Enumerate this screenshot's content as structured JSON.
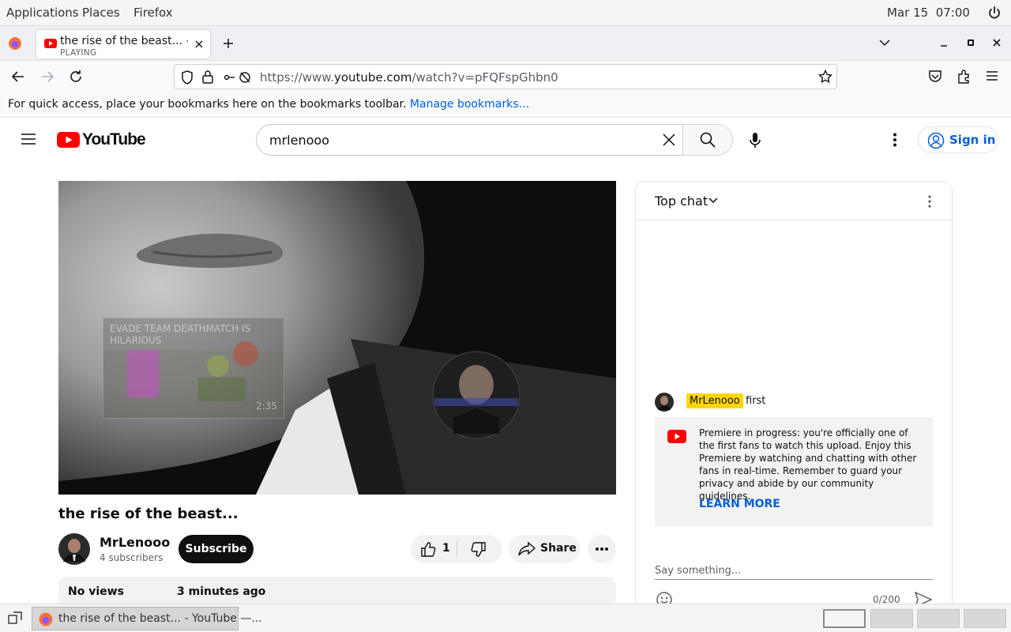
{
  "system_bar": {
    "menus": [
      "Applications",
      "Places",
      "Firefox"
    ],
    "datetime": "Mar 15  07:00"
  },
  "browser": {
    "tab": {
      "title": "the rise of the beast... - YouTube",
      "status": "PLAYING"
    },
    "url": {
      "prefix": "https://www.",
      "domain": "youtube.com",
      "path": "/watch?v=pFQFspGhbn0"
    },
    "bookmarks_message": "For quick access, place your bookmarks here on the bookmarks toolbar.",
    "bookmarks_link": "Manage bookmarks…"
  },
  "youtube": {
    "logo_text": "YouTube",
    "search_query": "mrlenooo",
    "sign_in_label": "Sign in"
  },
  "video": {
    "title": "the rise of the beast...",
    "endcard_title": "EVADE TEAM DEATHMATCH IS HILARIOUS",
    "endcard_duration": "2:35",
    "channel_name": "MrLenooo",
    "subscribers": "4 subscribers",
    "subscribe_label": "Subscribe",
    "like_count": "1",
    "share_label": "Share",
    "views": "No views",
    "posted": "3 minutes ago"
  },
  "chat": {
    "header": "Top chat",
    "message": {
      "author": "MrLenooo",
      "text": "first"
    },
    "banner_text": "Premiere in progress: you're officially one of the first fans to watch this upload. Enjoy this Premiere by watching and chatting with other fans in real-time. Remember to guard your privacy and abide by our community guidelines.",
    "learn_more": "LEARN MORE",
    "input_placeholder": "Say something...",
    "char_counter": "0/200"
  },
  "taskbar": {
    "window_title": "the rise of the beast... - YouTube —..."
  },
  "colors": {
    "youtube_red": "#ff0000",
    "link_blue": "#065fd4",
    "author_badge": "#ffd600"
  }
}
